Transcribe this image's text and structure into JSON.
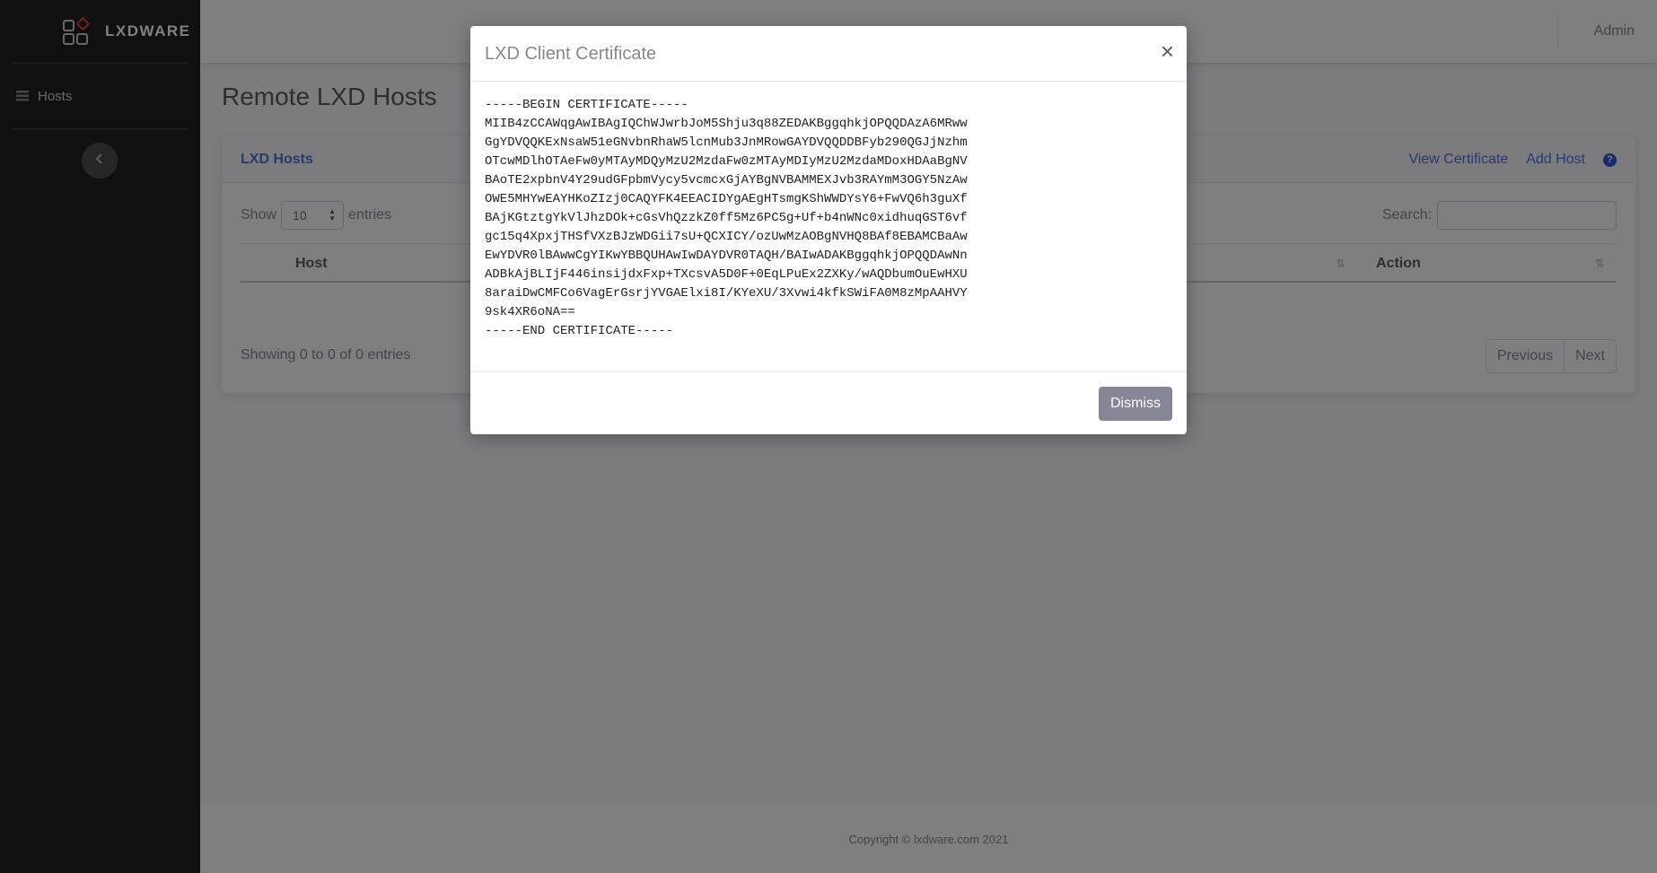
{
  "brand": {
    "name": "LXDWARE"
  },
  "sidebar": {
    "items": [
      {
        "label": "Hosts",
        "icon": "table-icon"
      }
    ],
    "toggle_icon": "chevron-left-icon"
  },
  "topbar": {
    "user_label": "Admin"
  },
  "page": {
    "title": "Remote LXD Hosts"
  },
  "card": {
    "title": "LXD Hosts",
    "actions": {
      "view_certificate": "View Certificate",
      "add_host": "Add Host",
      "help": "?"
    },
    "show_label": "Show",
    "entries_label": "entries",
    "page_length": "10",
    "search_label": "Search:",
    "search_value": "",
    "columns": [
      "Host",
      "Action"
    ],
    "info": "Showing 0 to 0 of 0 entries",
    "pager": {
      "previous": "Previous",
      "next": "Next"
    }
  },
  "footer": {
    "copyright": "Copyright © lxdware.com 2021"
  },
  "modal": {
    "title": "LXD Client Certificate",
    "close_symbol": "×",
    "certificate": "-----BEGIN CERTIFICATE-----\nMIIB4zCCAWqgAwIBAgIQChWJwrbJoM5Shju3q88ZEDAKBggqhkjOPQQDAzA6MRww\nGgYDVQQKExNsaW51eGNvbnRhaW5lcnMub3JnMRowGAYDVQQDDBFyb290QGJjNzhm\nOTcwMDlhOTAeFw0yMTAyMDQyMzU2MzdaFw0zMTAyMDIyMzU2MzdaMDoxHDAaBgNV\nBAoTE2xpbnV4Y29udGFpbmVycy5vcmcxGjAYBgNVBAMMEXJvb3RAYmM3OGY5NzAw\nOWE5MHYwEAYHKoZIzj0CAQYFK4EEACIDYgAEgHTsmgKShWWDYsY6+FwVQ6h3guXf\nBAjKGtztgYkVlJhzDOk+cGsVhQzzkZ0ff5Mz6PC5g+Uf+b4nWNc0xidhuqGST6vf\ngc15q4XpxjTHSfVXzBJzWDGii7sU+QCXICY/ozUwMzAOBgNVHQ8BAf8EBAMCBaAw\nEwYDVR0lBAwwCgYIKwYBBQUHAwIwDAYDVR0TAQH/BAIwADAKBggqhkjOPQQDAwNn\nADBkAjBLIjF446insijdxFxp+TXcsvA5D0F+0EqLPuEx2ZXKy/wAQDbumOuEwHXU\n8araiDwCMFCo6VagErGsrjYVGAElxi8I/KYeXU/3Xvwi4kfkSWiFA0M8zMpAAHVY\n9sk4XR6oNA==\n-----END CERTIFICATE-----",
    "dismiss_label": "Dismiss"
  }
}
